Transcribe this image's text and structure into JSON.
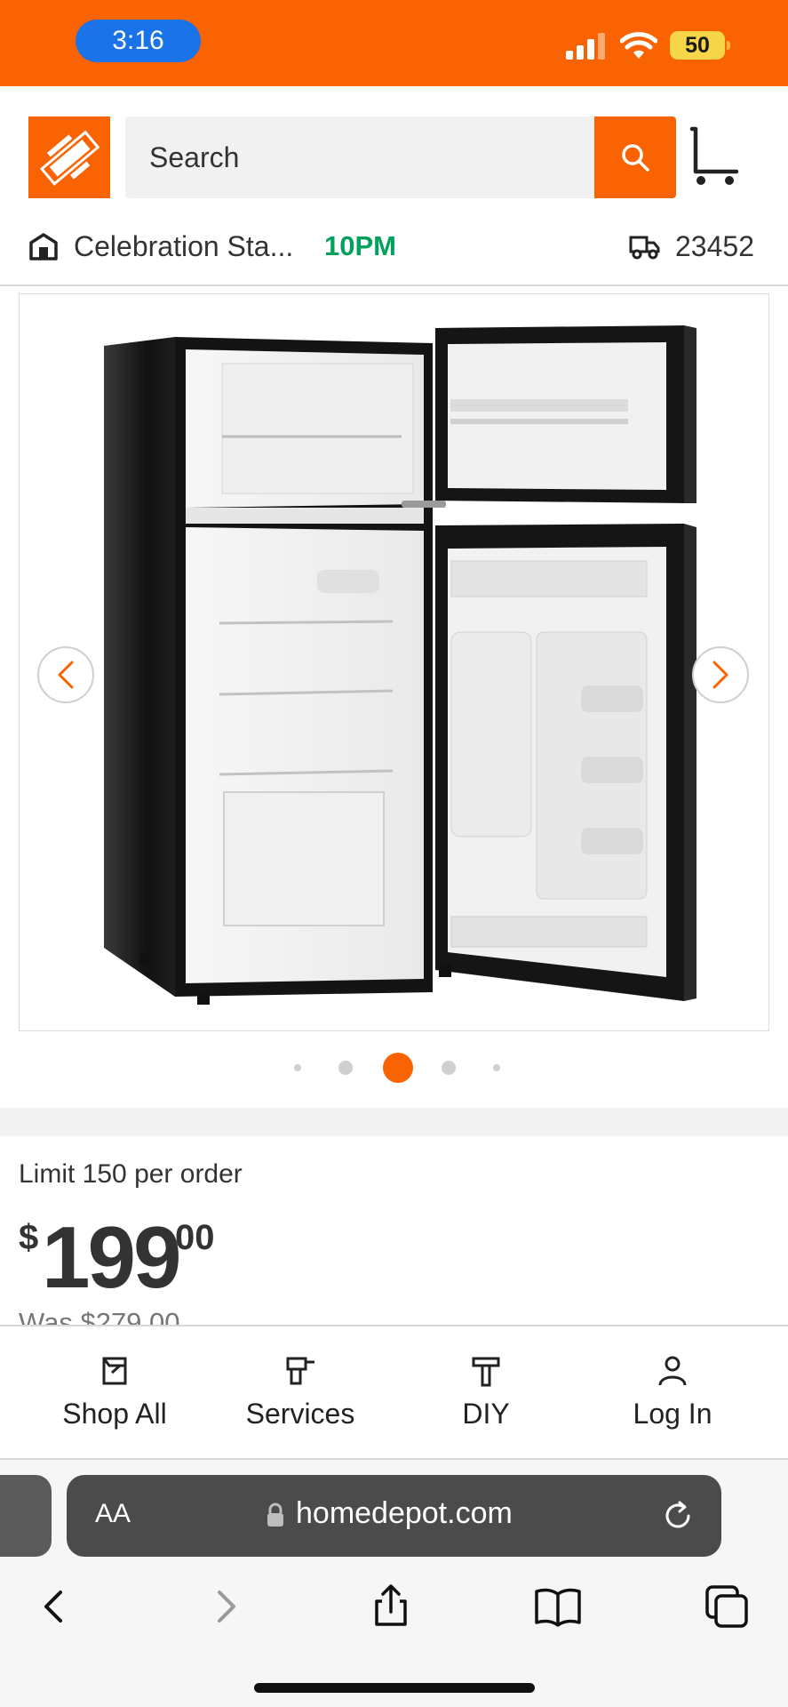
{
  "status_bar": {
    "time": "3:16",
    "battery": "50",
    "colors": {
      "background": "#f96302",
      "time_pill": "#1a73e8",
      "battery": "#f7d548"
    }
  },
  "header": {
    "logo_icon": "home-depot-logo",
    "search": {
      "placeholder": "Search",
      "button_icon": "search-icon"
    },
    "cart_icon": "cart-icon",
    "store": {
      "icon": "store-icon",
      "name": "Celebration Sta...",
      "hours": "10PM"
    },
    "delivery": {
      "icon": "truck-icon",
      "zip": "23452"
    }
  },
  "carousel": {
    "prev_icon": "chevron-left-icon",
    "next_icon": "chevron-right-icon",
    "image": "product-image-refrigerator-open",
    "dots_count": 5,
    "active_dot": 3
  },
  "product": {
    "limit": "Limit 150 per order",
    "price": {
      "currency": "$",
      "whole": "199",
      "cents": "00"
    },
    "was_price": "Was $279.00"
  },
  "bottom_nav": {
    "items": [
      {
        "label": "Shop All",
        "icon": "shop-all-icon"
      },
      {
        "label": "Services",
        "icon": "services-drill-icon"
      },
      {
        "label": "DIY",
        "icon": "diy-hammer-icon"
      },
      {
        "label": "Log In",
        "icon": "user-icon"
      }
    ]
  },
  "browser": {
    "text_size": "AA",
    "url": "homedepot.com",
    "toolbar": [
      "back-icon",
      "forward-icon",
      "share-icon",
      "bookmarks-icon",
      "tabs-icon"
    ]
  },
  "colors": {
    "accent": "#f96302",
    "open_hours": "#00a15a"
  }
}
